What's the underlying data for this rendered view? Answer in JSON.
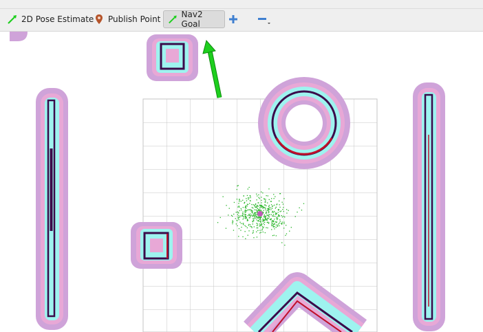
{
  "toolbar": {
    "tools": [
      {
        "label": "2D Pose Estimate",
        "icon": "green-arrow-icon"
      },
      {
        "label": "Publish Point",
        "icon": "map-pin-icon"
      },
      {
        "label": "Nav2 Goal",
        "icon": "green-arrow-icon",
        "active": true
      }
    ],
    "add_icon": "plus-icon",
    "remove_icon": "minus-dropdown-icon"
  },
  "colors": {
    "toolbar_bg": "#efefef",
    "obstacle": "#3b0a4a",
    "obstacle_red": "#c0102a",
    "inflation_cyan": "#9ef3ef",
    "inflation_pink": "#e8a8d6",
    "inflation_lilac": "#cfa3d9",
    "grid": "#c6c6c6",
    "goal_arrow": "#1ecf1e",
    "particles": "#22b322"
  }
}
